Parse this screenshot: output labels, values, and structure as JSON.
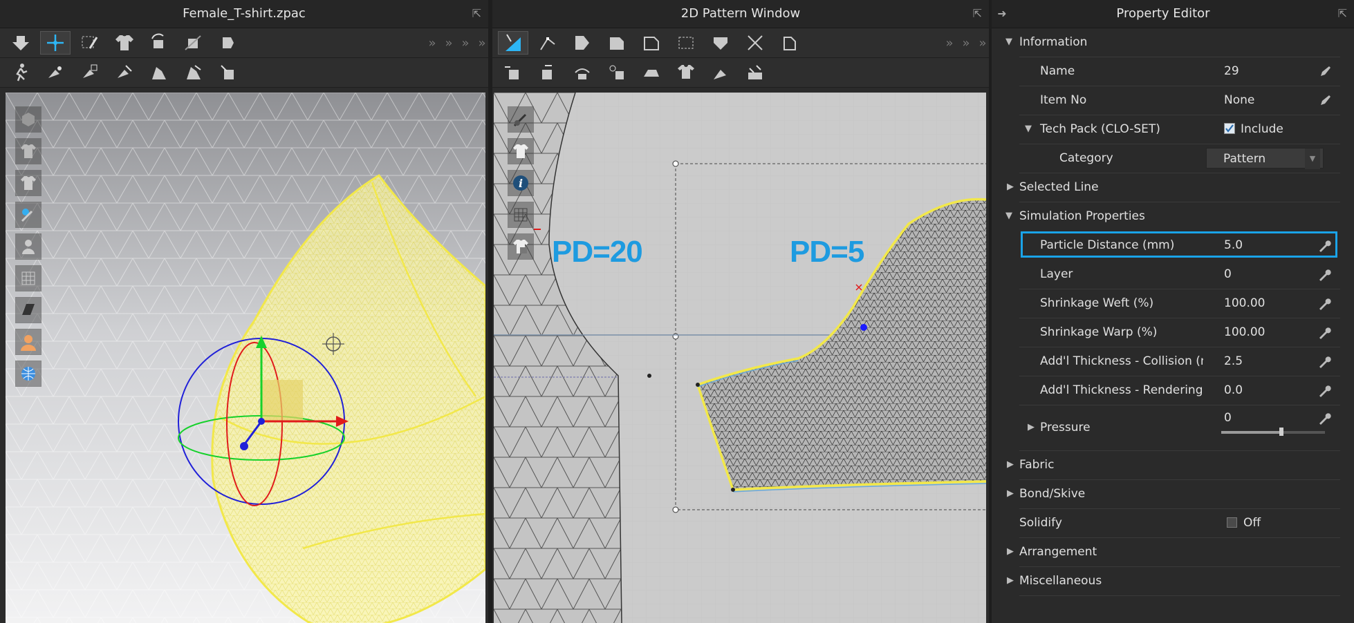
{
  "panels": {
    "view3d": {
      "title": "Female_T-shirt.zpac"
    },
    "pattern2d": {
      "title": "2D Pattern Window",
      "labels": {
        "left": "PD=20",
        "right": "PD=5"
      }
    },
    "property_editor": {
      "title": "Property Editor"
    }
  },
  "props": {
    "information": {
      "label": "Information"
    },
    "name": {
      "label": "Name",
      "value": "29"
    },
    "item_no": {
      "label": "Item No",
      "value": "None"
    },
    "tech_pack": {
      "label": "Tech Pack (CLO-SET)",
      "checkbox_label": "Include",
      "checked": true
    },
    "category": {
      "label": "Category",
      "value": "Pattern"
    },
    "selected_line": {
      "label": "Selected Line"
    },
    "simulation": {
      "label": "Simulation Properties"
    },
    "particle_distance": {
      "label": "Particle Distance (mm)",
      "value": "5.0"
    },
    "layer": {
      "label": "Layer",
      "value": "0"
    },
    "shrink_weft": {
      "label": "Shrinkage Weft (%)",
      "value": "100.00"
    },
    "shrink_warp": {
      "label": "Shrinkage Warp (%)",
      "value": "100.00"
    },
    "thick_collision": {
      "label": "Add'l Thickness - Collision (m",
      "value": "2.5"
    },
    "thick_rendering": {
      "label": "Add'l Thickness - Rendering (r",
      "value": "0.0"
    },
    "pressure": {
      "label": "Pressure",
      "value": "0",
      "slider_level": 0.58
    },
    "fabric": {
      "label": "Fabric"
    },
    "bond": {
      "label": "Bond/Skive"
    },
    "solidify": {
      "label": "Solidify",
      "checkbox_label": "Off",
      "checked": false
    },
    "arrangement": {
      "label": "Arrangement"
    },
    "misc": {
      "label": "Miscellaneous"
    }
  },
  "colors": {
    "accent": "#35aef0",
    "highlight_border": "#1aa3e8",
    "pattern_outline": "#f2e84a",
    "gizmo_x": "#e01b1b",
    "gizmo_y": "#16d12b",
    "gizmo_z": "#2020d8"
  },
  "icons": {
    "toolbar3d_row1": [
      "down-arrow-icon",
      "move-gizmo-icon",
      "select-mesh-icon",
      "garment-icon",
      "rotate-pattern-icon",
      "fold-icon",
      "fold-arrangement-icon"
    ],
    "toolbar3d_row2": [
      "pose-icon",
      "pin-icon",
      "pin-box-icon",
      "tack-icon",
      "steam-icon",
      "avatar-measure-icon",
      "measure-icon"
    ],
    "toolbar2d_row1": [
      "transform-pattern-icon",
      "edit-point-icon",
      "polygon-icon",
      "rectangle-icon",
      "internal-polygon-icon",
      "dart-icon",
      "trace-icon",
      "notch-icon",
      "seam-icon"
    ],
    "toolbar2d_row2": [
      "segment-sewing-icon",
      "free-sewing-icon",
      "check-sewing-icon",
      "tack-2d-icon",
      "iron-icon",
      "show-avatar-icon",
      "fold-2d-icon",
      "puckering-icon"
    ]
  }
}
